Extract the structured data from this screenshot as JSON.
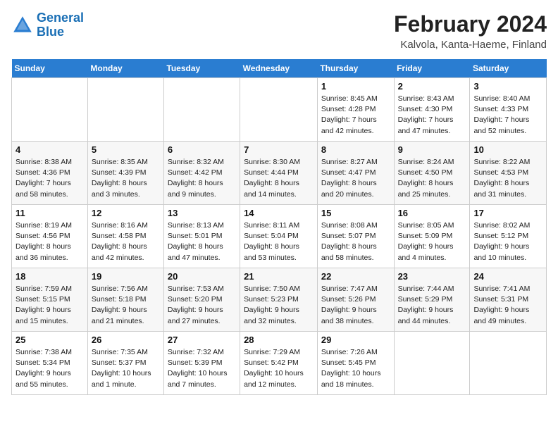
{
  "logo": {
    "line1": "General",
    "line2": "Blue"
  },
  "title": "February 2024",
  "subtitle": "Kalvola, Kanta-Haeme, Finland",
  "headers": [
    "Sunday",
    "Monday",
    "Tuesday",
    "Wednesday",
    "Thursday",
    "Friday",
    "Saturday"
  ],
  "weeks": [
    [
      {
        "day": "",
        "info": ""
      },
      {
        "day": "",
        "info": ""
      },
      {
        "day": "",
        "info": ""
      },
      {
        "day": "",
        "info": ""
      },
      {
        "day": "1",
        "info": "Sunrise: 8:45 AM\nSunset: 4:28 PM\nDaylight: 7 hours\nand 42 minutes."
      },
      {
        "day": "2",
        "info": "Sunrise: 8:43 AM\nSunset: 4:30 PM\nDaylight: 7 hours\nand 47 minutes."
      },
      {
        "day": "3",
        "info": "Sunrise: 8:40 AM\nSunset: 4:33 PM\nDaylight: 7 hours\nand 52 minutes."
      }
    ],
    [
      {
        "day": "4",
        "info": "Sunrise: 8:38 AM\nSunset: 4:36 PM\nDaylight: 7 hours\nand 58 minutes."
      },
      {
        "day": "5",
        "info": "Sunrise: 8:35 AM\nSunset: 4:39 PM\nDaylight: 8 hours\nand 3 minutes."
      },
      {
        "day": "6",
        "info": "Sunrise: 8:32 AM\nSunset: 4:42 PM\nDaylight: 8 hours\nand 9 minutes."
      },
      {
        "day": "7",
        "info": "Sunrise: 8:30 AM\nSunset: 4:44 PM\nDaylight: 8 hours\nand 14 minutes."
      },
      {
        "day": "8",
        "info": "Sunrise: 8:27 AM\nSunset: 4:47 PM\nDaylight: 8 hours\nand 20 minutes."
      },
      {
        "day": "9",
        "info": "Sunrise: 8:24 AM\nSunset: 4:50 PM\nDaylight: 8 hours\nand 25 minutes."
      },
      {
        "day": "10",
        "info": "Sunrise: 8:22 AM\nSunset: 4:53 PM\nDaylight: 8 hours\nand 31 minutes."
      }
    ],
    [
      {
        "day": "11",
        "info": "Sunrise: 8:19 AM\nSunset: 4:56 PM\nDaylight: 8 hours\nand 36 minutes."
      },
      {
        "day": "12",
        "info": "Sunrise: 8:16 AM\nSunset: 4:58 PM\nDaylight: 8 hours\nand 42 minutes."
      },
      {
        "day": "13",
        "info": "Sunrise: 8:13 AM\nSunset: 5:01 PM\nDaylight: 8 hours\nand 47 minutes."
      },
      {
        "day": "14",
        "info": "Sunrise: 8:11 AM\nSunset: 5:04 PM\nDaylight: 8 hours\nand 53 minutes."
      },
      {
        "day": "15",
        "info": "Sunrise: 8:08 AM\nSunset: 5:07 PM\nDaylight: 8 hours\nand 58 minutes."
      },
      {
        "day": "16",
        "info": "Sunrise: 8:05 AM\nSunset: 5:09 PM\nDaylight: 9 hours\nand 4 minutes."
      },
      {
        "day": "17",
        "info": "Sunrise: 8:02 AM\nSunset: 5:12 PM\nDaylight: 9 hours\nand 10 minutes."
      }
    ],
    [
      {
        "day": "18",
        "info": "Sunrise: 7:59 AM\nSunset: 5:15 PM\nDaylight: 9 hours\nand 15 minutes."
      },
      {
        "day": "19",
        "info": "Sunrise: 7:56 AM\nSunset: 5:18 PM\nDaylight: 9 hours\nand 21 minutes."
      },
      {
        "day": "20",
        "info": "Sunrise: 7:53 AM\nSunset: 5:20 PM\nDaylight: 9 hours\nand 27 minutes."
      },
      {
        "day": "21",
        "info": "Sunrise: 7:50 AM\nSunset: 5:23 PM\nDaylight: 9 hours\nand 32 minutes."
      },
      {
        "day": "22",
        "info": "Sunrise: 7:47 AM\nSunset: 5:26 PM\nDaylight: 9 hours\nand 38 minutes."
      },
      {
        "day": "23",
        "info": "Sunrise: 7:44 AM\nSunset: 5:29 PM\nDaylight: 9 hours\nand 44 minutes."
      },
      {
        "day": "24",
        "info": "Sunrise: 7:41 AM\nSunset: 5:31 PM\nDaylight: 9 hours\nand 49 minutes."
      }
    ],
    [
      {
        "day": "25",
        "info": "Sunrise: 7:38 AM\nSunset: 5:34 PM\nDaylight: 9 hours\nand 55 minutes."
      },
      {
        "day": "26",
        "info": "Sunrise: 7:35 AM\nSunset: 5:37 PM\nDaylight: 10 hours\nand 1 minute."
      },
      {
        "day": "27",
        "info": "Sunrise: 7:32 AM\nSunset: 5:39 PM\nDaylight: 10 hours\nand 7 minutes."
      },
      {
        "day": "28",
        "info": "Sunrise: 7:29 AM\nSunset: 5:42 PM\nDaylight: 10 hours\nand 12 minutes."
      },
      {
        "day": "29",
        "info": "Sunrise: 7:26 AM\nSunset: 5:45 PM\nDaylight: 10 hours\nand 18 minutes."
      },
      {
        "day": "",
        "info": ""
      },
      {
        "day": "",
        "info": ""
      }
    ]
  ]
}
